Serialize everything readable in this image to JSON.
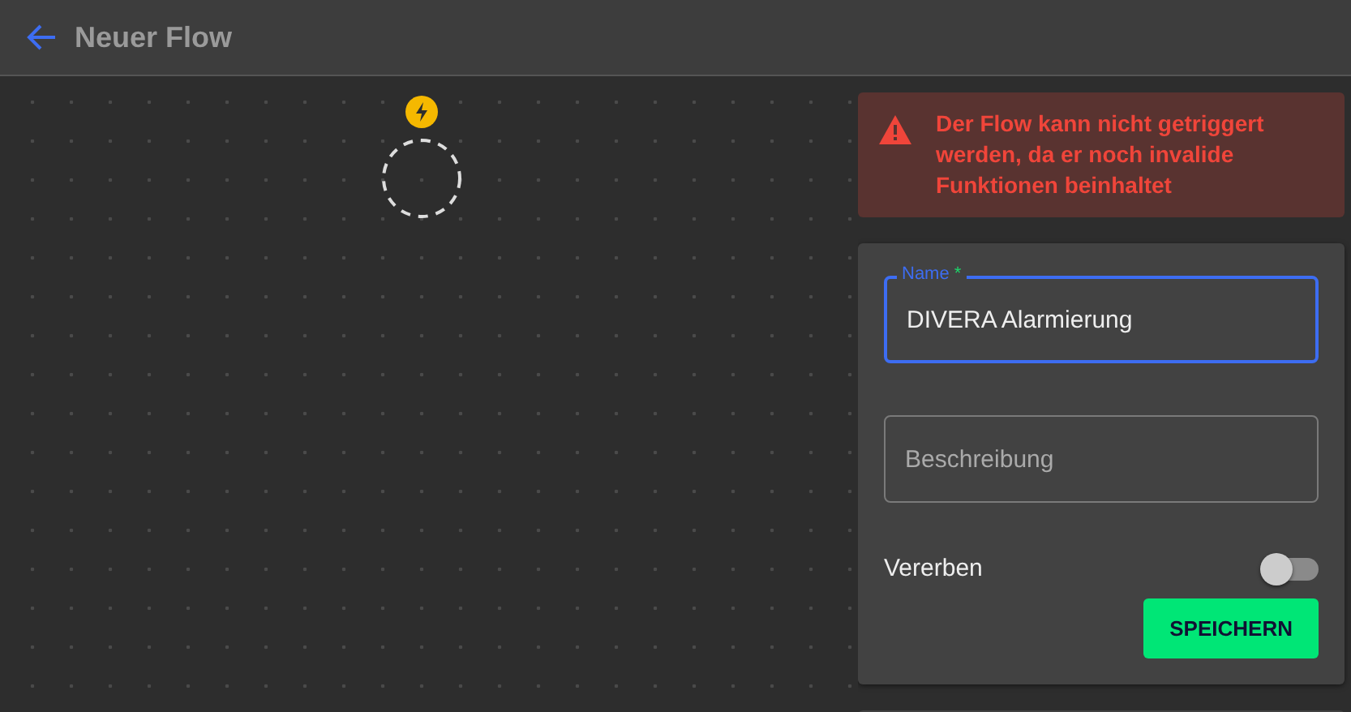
{
  "header": {
    "title": "Neuer Flow"
  },
  "alert": {
    "message": "Der Flow kann nicht getriggert werden, da er noch invalide Funktionen beinhaltet"
  },
  "form": {
    "name_field": {
      "label": "Name",
      "required_mark": "*",
      "value": "DIVERA Alarmierung",
      "focused": true
    },
    "description_field": {
      "placeholder": "Beschreibung"
    },
    "inherit_toggle": {
      "label": "Vererben",
      "on": false
    },
    "save_button": "SPEICHERN"
  }
}
